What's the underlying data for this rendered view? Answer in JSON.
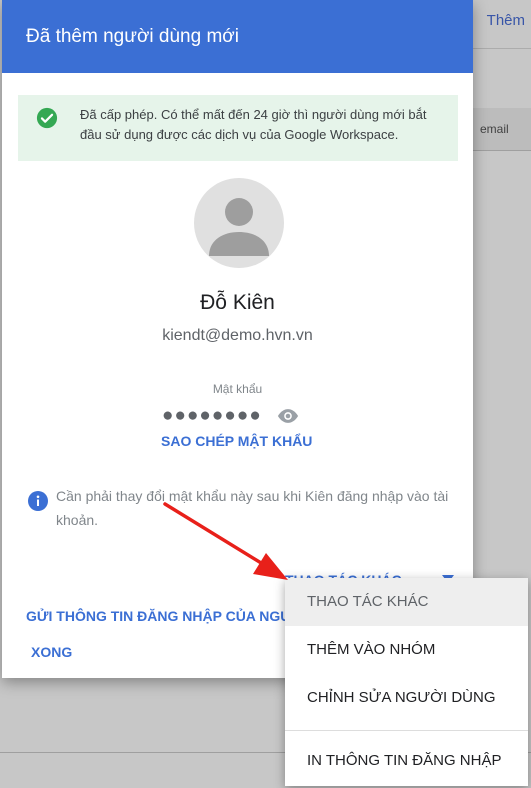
{
  "background": {
    "top_link": "Thêm",
    "column_header": "email"
  },
  "dialog": {
    "title": "Đã thêm người dùng mới",
    "notice": "Đã cấp phép. Có thể mất đến 24 giờ thì người dùng mới bắt đầu sử dụng được các dịch vụ của Google Workspace.",
    "user_name": "Đỗ Kiên",
    "user_email": "kiendt@demo.hvn.vn",
    "password_label": "Mật khẩu",
    "password_mask": "●●●●●●●●",
    "copy_password": "SAO CHÉP MẬT KHẨU",
    "info_text": "Cần phải thay đổi mật khẩu này sau khi Kiên đăng nhập vào tài khoản.",
    "more_actions": "THAO TÁC KHÁC",
    "send_login": "GỬI THÔNG TIN ĐĂNG NHẬP CỦA NGƯ",
    "done": "XONG"
  },
  "menu": {
    "items": [
      "THAO TÁC KHÁC",
      "THÊM VÀO NHÓM",
      "CHỈNH SỬA NGƯỜI DÙNG",
      "IN THÔNG TIN ĐĂNG NHẬP"
    ]
  },
  "colors": {
    "accent": "#3b6fd4",
    "success": "#34a853",
    "arrow": "#e8201a"
  }
}
